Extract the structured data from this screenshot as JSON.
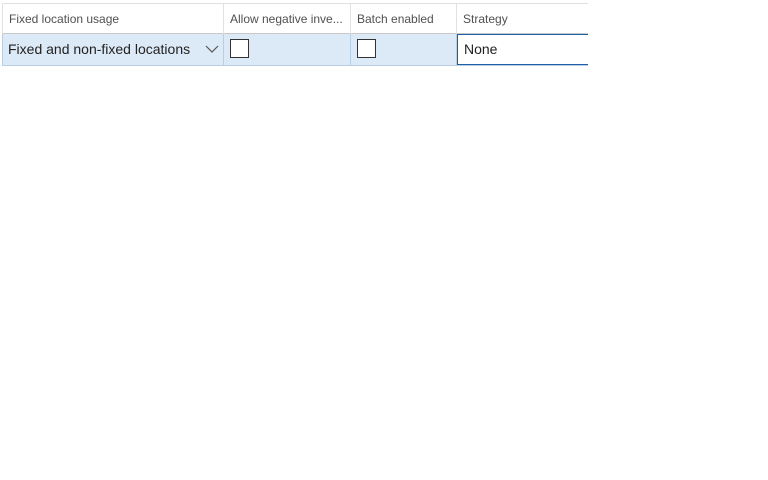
{
  "grid": {
    "columns": [
      {
        "label": "Fixed location usage"
      },
      {
        "label": "Allow negative inve..."
      },
      {
        "label": "Batch enabled"
      },
      {
        "label": "Strategy"
      }
    ],
    "row": {
      "fixed_location_usage": "Fixed and non-fixed locations",
      "allow_negative_inventory": false,
      "batch_enabled": false,
      "strategy": "None"
    }
  }
}
